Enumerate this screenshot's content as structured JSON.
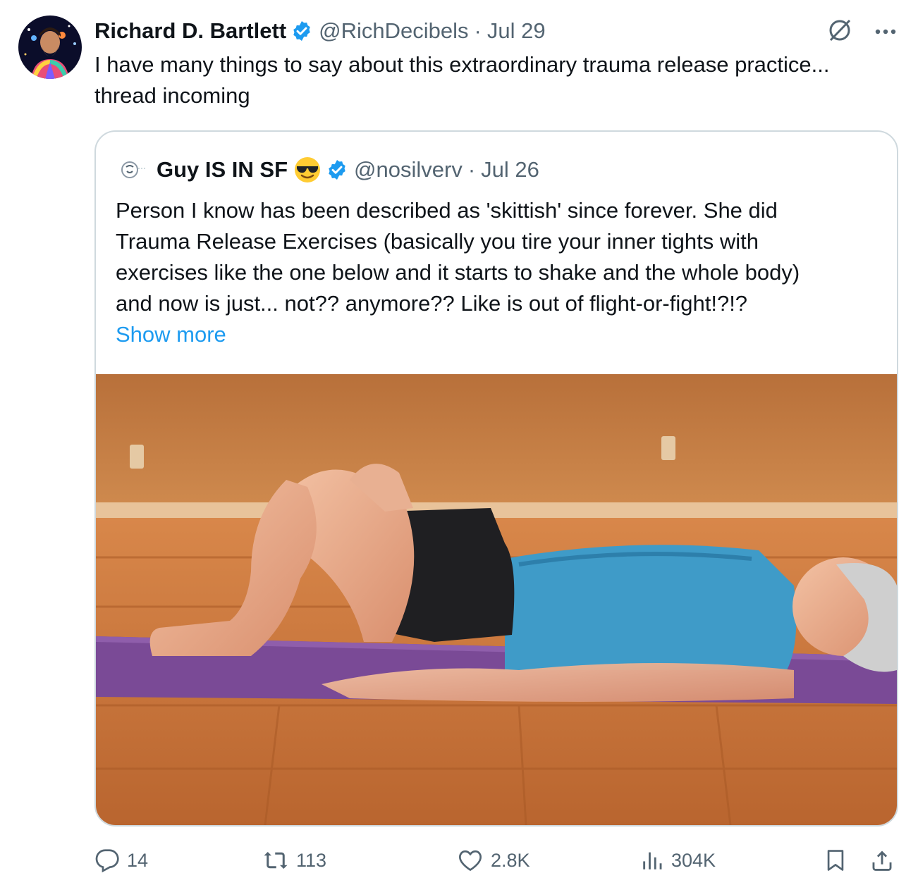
{
  "tweet": {
    "author_name": "Richard D. Bartlett",
    "handle": "@RichDecibels",
    "separator": "·",
    "date": "Jul 29",
    "text": "I have many things to say about this extraordinary trauma release practice...\nthread incoming"
  },
  "quoted_tweet": {
    "author_name": "Guy IS IN SF",
    "handle": "@nosilverv",
    "separator": "·",
    "date": "Jul 26",
    "text": "Person I know has been described as 'skittish' since forever. She did\nTrauma Release Exercises (basically you tire your inner tights with\nexercises like the one below and it starts to shake and the whole body)\nand now is just... not?? anymore?? Like is out of flight-or-fight!?!?",
    "show_more_label": "Show more"
  },
  "actions": {
    "replies": "14",
    "reposts": "113",
    "likes": "2.8K",
    "views": "304K"
  },
  "icons": {
    "verified": "verified-badge-icon",
    "grok": "grok-icon",
    "more": "more-icon",
    "reply": "reply-icon",
    "repost": "repost-icon",
    "like": "like-icon",
    "views": "views-icon",
    "bookmark": "bookmark-icon",
    "share": "share-icon"
  },
  "colors": {
    "accent": "#1d9bf0",
    "text_primary": "#0f1419",
    "text_secondary": "#536471",
    "border": "#cfd9de"
  }
}
